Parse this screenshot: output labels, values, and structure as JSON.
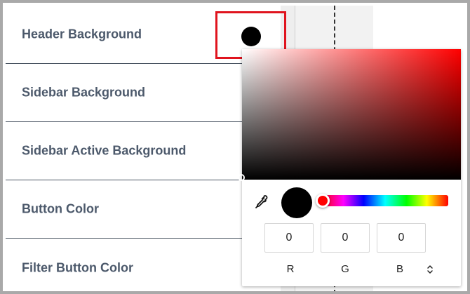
{
  "settings": {
    "items": [
      {
        "label": "Header Background"
      },
      {
        "label": "Sidebar Background"
      },
      {
        "label": "Sidebar Active Background"
      },
      {
        "label": "Button Color"
      },
      {
        "label": "Filter Button Color"
      }
    ],
    "header_swatch_color": "#000000",
    "highlight_color": "#e0141e"
  },
  "color_picker": {
    "hue_color": "#ff0000",
    "selected_color": "#000000",
    "hue_position": 0,
    "channels": [
      {
        "label": "R",
        "value": "0"
      },
      {
        "label": "G",
        "value": "0"
      },
      {
        "label": "B",
        "value": "0"
      }
    ],
    "icons": {
      "eyedropper": "eyedropper-icon",
      "mode_toggle": "chevron-up-down-icon"
    }
  },
  "colors": {
    "label_text": "#4c596b",
    "divider": "#4a5562",
    "frame_border": "#a9a9a9"
  }
}
